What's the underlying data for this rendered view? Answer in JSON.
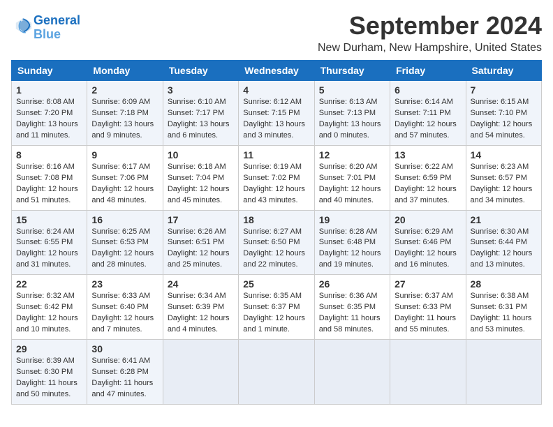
{
  "logo": {
    "line1": "General",
    "line2": "Blue"
  },
  "title": "September 2024",
  "location": "New Durham, New Hampshire, United States",
  "weekdays": [
    "Sunday",
    "Monday",
    "Tuesday",
    "Wednesday",
    "Thursday",
    "Friday",
    "Saturday"
  ],
  "weeks": [
    [
      {
        "day": "1",
        "sunrise": "6:08 AM",
        "sunset": "7:20 PM",
        "daylight": "13 hours and 11 minutes."
      },
      {
        "day": "2",
        "sunrise": "6:09 AM",
        "sunset": "7:18 PM",
        "daylight": "13 hours and 9 minutes."
      },
      {
        "day": "3",
        "sunrise": "6:10 AM",
        "sunset": "7:17 PM",
        "daylight": "13 hours and 6 minutes."
      },
      {
        "day": "4",
        "sunrise": "6:12 AM",
        "sunset": "7:15 PM",
        "daylight": "13 hours and 3 minutes."
      },
      {
        "day": "5",
        "sunrise": "6:13 AM",
        "sunset": "7:13 PM",
        "daylight": "13 hours and 0 minutes."
      },
      {
        "day": "6",
        "sunrise": "6:14 AM",
        "sunset": "7:11 PM",
        "daylight": "12 hours and 57 minutes."
      },
      {
        "day": "7",
        "sunrise": "6:15 AM",
        "sunset": "7:10 PM",
        "daylight": "12 hours and 54 minutes."
      }
    ],
    [
      {
        "day": "8",
        "sunrise": "6:16 AM",
        "sunset": "7:08 PM",
        "daylight": "12 hours and 51 minutes."
      },
      {
        "day": "9",
        "sunrise": "6:17 AM",
        "sunset": "7:06 PM",
        "daylight": "12 hours and 48 minutes."
      },
      {
        "day": "10",
        "sunrise": "6:18 AM",
        "sunset": "7:04 PM",
        "daylight": "12 hours and 45 minutes."
      },
      {
        "day": "11",
        "sunrise": "6:19 AM",
        "sunset": "7:02 PM",
        "daylight": "12 hours and 43 minutes."
      },
      {
        "day": "12",
        "sunrise": "6:20 AM",
        "sunset": "7:01 PM",
        "daylight": "12 hours and 40 minutes."
      },
      {
        "day": "13",
        "sunrise": "6:22 AM",
        "sunset": "6:59 PM",
        "daylight": "12 hours and 37 minutes."
      },
      {
        "day": "14",
        "sunrise": "6:23 AM",
        "sunset": "6:57 PM",
        "daylight": "12 hours and 34 minutes."
      }
    ],
    [
      {
        "day": "15",
        "sunrise": "6:24 AM",
        "sunset": "6:55 PM",
        "daylight": "12 hours and 31 minutes."
      },
      {
        "day": "16",
        "sunrise": "6:25 AM",
        "sunset": "6:53 PM",
        "daylight": "12 hours and 28 minutes."
      },
      {
        "day": "17",
        "sunrise": "6:26 AM",
        "sunset": "6:51 PM",
        "daylight": "12 hours and 25 minutes."
      },
      {
        "day": "18",
        "sunrise": "6:27 AM",
        "sunset": "6:50 PM",
        "daylight": "12 hours and 22 minutes."
      },
      {
        "day": "19",
        "sunrise": "6:28 AM",
        "sunset": "6:48 PM",
        "daylight": "12 hours and 19 minutes."
      },
      {
        "day": "20",
        "sunrise": "6:29 AM",
        "sunset": "6:46 PM",
        "daylight": "12 hours and 16 minutes."
      },
      {
        "day": "21",
        "sunrise": "6:30 AM",
        "sunset": "6:44 PM",
        "daylight": "12 hours and 13 minutes."
      }
    ],
    [
      {
        "day": "22",
        "sunrise": "6:32 AM",
        "sunset": "6:42 PM",
        "daylight": "12 hours and 10 minutes."
      },
      {
        "day": "23",
        "sunrise": "6:33 AM",
        "sunset": "6:40 PM",
        "daylight": "12 hours and 7 minutes."
      },
      {
        "day": "24",
        "sunrise": "6:34 AM",
        "sunset": "6:39 PM",
        "daylight": "12 hours and 4 minutes."
      },
      {
        "day": "25",
        "sunrise": "6:35 AM",
        "sunset": "6:37 PM",
        "daylight": "12 hours and 1 minute."
      },
      {
        "day": "26",
        "sunrise": "6:36 AM",
        "sunset": "6:35 PM",
        "daylight": "11 hours and 58 minutes."
      },
      {
        "day": "27",
        "sunrise": "6:37 AM",
        "sunset": "6:33 PM",
        "daylight": "11 hours and 55 minutes."
      },
      {
        "day": "28",
        "sunrise": "6:38 AM",
        "sunset": "6:31 PM",
        "daylight": "11 hours and 53 minutes."
      }
    ],
    [
      {
        "day": "29",
        "sunrise": "6:39 AM",
        "sunset": "6:30 PM",
        "daylight": "11 hours and 50 minutes."
      },
      {
        "day": "30",
        "sunrise": "6:41 AM",
        "sunset": "6:28 PM",
        "daylight": "11 hours and 47 minutes."
      },
      null,
      null,
      null,
      null,
      null
    ]
  ],
  "labels": {
    "sunrise": "Sunrise:",
    "sunset": "Sunset:",
    "daylight": "Daylight:"
  }
}
